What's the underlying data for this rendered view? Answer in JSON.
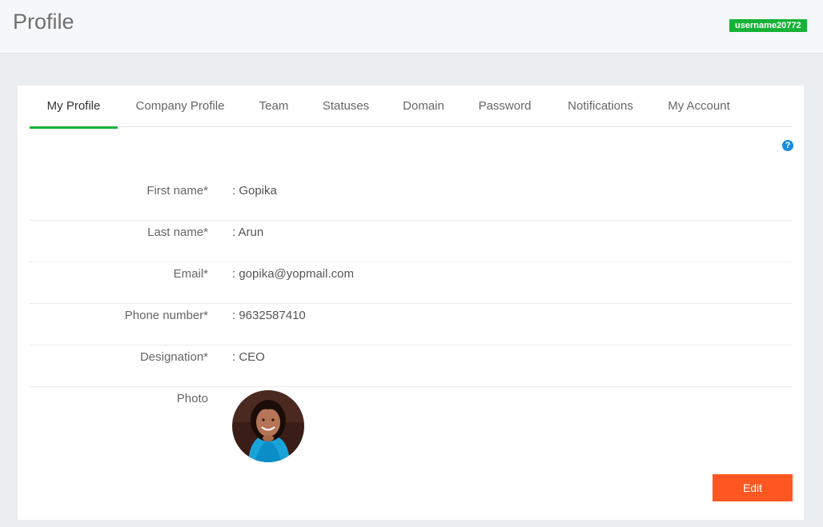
{
  "header": {
    "title": "Profile",
    "username": "username20772"
  },
  "tabs": [
    {
      "label": "My Profile",
      "active": true
    },
    {
      "label": "Company Profile",
      "active": false
    },
    {
      "label": "Team",
      "active": false
    },
    {
      "label": "Statuses",
      "active": false
    },
    {
      "label": "Domain",
      "active": false
    },
    {
      "label": "Password",
      "active": false
    },
    {
      "label": "Notifications",
      "active": false
    },
    {
      "label": "My Account",
      "active": false
    }
  ],
  "help_icon": "?",
  "profile": {
    "first_name": {
      "label": "First name*",
      "value": ": Gopika"
    },
    "last_name": {
      "label": "Last name*",
      "value": ": Arun"
    },
    "email": {
      "label": "Email*",
      "value": ": gopika@yopmail.com"
    },
    "phone": {
      "label": "Phone number*",
      "value": ": 9632587410"
    },
    "designation": {
      "label": "Designation*",
      "value": ": CEO"
    },
    "photo": {
      "label": "Photo"
    }
  },
  "actions": {
    "edit_label": "Edit"
  },
  "colors": {
    "accent_green": "#16b237",
    "edit_orange": "#ff5722",
    "help_blue": "#1a8be3"
  }
}
